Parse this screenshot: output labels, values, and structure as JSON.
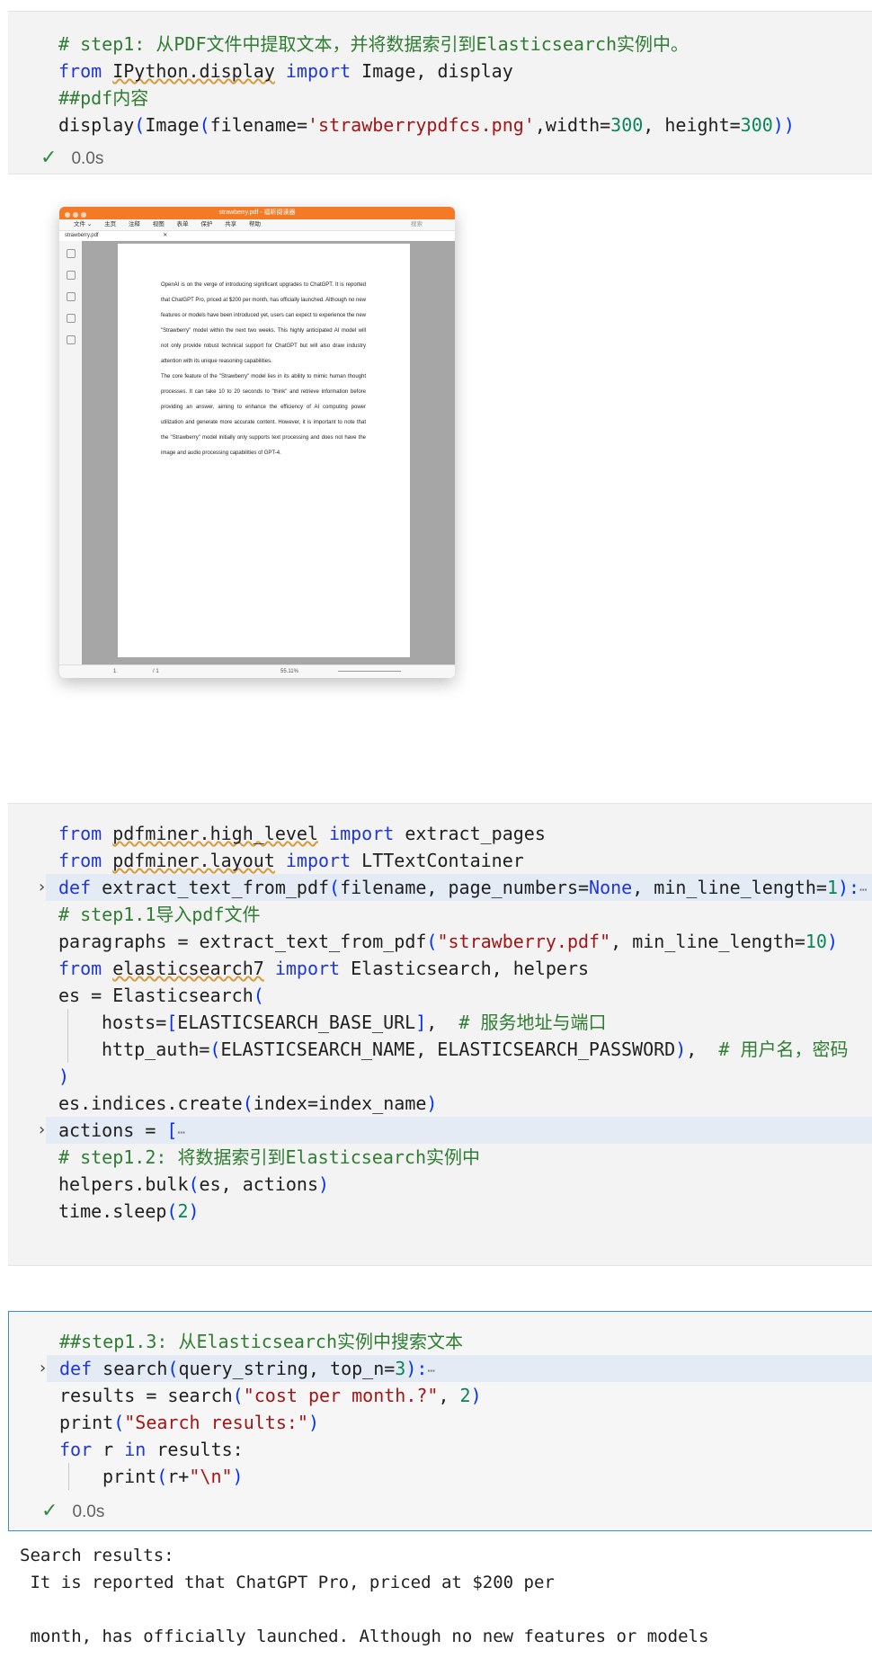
{
  "cell1": {
    "lines": {
      "l1": "# step1: 从PDF文件中提取文本，并将数据索引到Elasticsearch实例中。",
      "l2_from": "from",
      "l2_mod": "IPython.display",
      "l2_import": "import",
      "l2_rest": " Image, display",
      "l3": "##pdf内容",
      "l4_fn": "display",
      "l4_a": "(",
      "l4_b": "Image",
      "l4_c": "(",
      "l4_d": "filename=",
      "l4_str": "'strawberrypdfcs.png'",
      "l4_e": ",width=",
      "l4_n1": "300",
      "l4_f": ", height=",
      "l4_n2": "300",
      "l4_g": "))"
    },
    "status_time": "0.0s"
  },
  "embedded_screenshot": {
    "window_title": "strawberry.pdf - 福昕阅读器",
    "menu": [
      "文件 ⌄",
      "主页",
      "注释",
      "视图",
      "表单",
      "保护",
      "共享",
      "帮助"
    ],
    "tab": "strawberry.pdf",
    "tab_close": "✕",
    "search_placeholder": "搜索",
    "para1": "OpenAI is on the verge of introducing significant upgrades to ChatGPT. It is reported that ChatGPT Pro, priced at $200 per month, has officially launched. Although no new features or models have been introduced yet, users can expect to experience the new \"Strawberry\" model within the next two weeks. This highly anticipated AI model will not only provide robust technical support for ChatGPT but will also draw industry attention with its unique reasoning capabilities.",
    "para2": "The core feature of the \"Strawberry\" model lies in its ability to mimic human thought processes. It can take 10 to 20 seconds to \"think\" and retrieve information before providing an answer, aiming to enhance the efficiency of AI computing power utilization and generate more accurate content. However, it is important to note that the \"Strawberry\" model initially only supports text processing and does not have the image and audio processing capabilities of GPT-4.",
    "page_number": "1",
    "page_total": "/ 1",
    "zoom": "55.11%"
  },
  "cell2": {
    "l1_from": "from",
    "l1_mod": "pdfminer.high_level",
    "l1_import": "import",
    "l1_rest": " extract_pages",
    "l2_from": "from",
    "l2_mod": "pdfminer.layout",
    "l2_import": "import",
    "l2_rest": " LTTextContainer",
    "l3_def": "def",
    "l3_name": " extract_text_from_pdf",
    "l3_a": "(",
    "l3_b": "filename, page_numbers=",
    "l3_none": "None",
    "l3_c": ", min_line_length=",
    "l3_n": "1",
    "l3_d": "):",
    "l4": "# step1.1导入pdf文件",
    "l5_a": "paragraphs = extract_text_from_pdf",
    "l5_b": "(",
    "l5_str": "\"strawberry.pdf\"",
    "l5_c": ", min_line_length=",
    "l5_n": "10",
    "l5_d": ")",
    "l6_from": "from",
    "l6_mod": "elasticsearch7",
    "l6_import": "import",
    "l6_rest": " Elasticsearch, helpers",
    "l7_a": "es = Elasticsearch",
    "l7_b": "(",
    "l8_a": "hosts=",
    "l8_b": "[",
    "l8_c": "ELASTICSEARCH_BASE_URL",
    "l8_d": "]",
    "l8_e": ",  ",
    "l8_cm": "# 服务地址与端口",
    "l9_a": "http_auth=",
    "l9_b": "(",
    "l9_c": "ELASTICSEARCH_NAME, ELASTICSEARCH_PASSWORD",
    "l9_d": ")",
    "l9_e": ",  ",
    "l9_cm": "# 用户名，密码",
    "l10": ")",
    "l11_a": "es.indices.create",
    "l11_b": "(",
    "l11_c": "index=index_name",
    "l11_d": ")",
    "l12_a": "actions = ",
    "l12_b": "[",
    "l13": "# step1.2: 将数据索引到Elasticsearch实例中",
    "l14_a": "helpers.bulk",
    "l14_b": "(",
    "l14_c": "es, actions",
    "l14_d": ")",
    "l15_a": "time.sleep",
    "l15_b": "(",
    "l15_n": "2",
    "l15_d": ")"
  },
  "cell3": {
    "l1": "##step1.3: 从Elasticsearch实例中搜索文本",
    "l2_def": "def",
    "l2_name": " search",
    "l2_a": "(",
    "l2_b": "query_string, top_n=",
    "l2_n": "3",
    "l2_c": "):",
    "l3_a": "results = search",
    "l3_b": "(",
    "l3_str": "\"cost per month.?\"",
    "l3_c": ", ",
    "l3_n": "2",
    "l3_d": ")",
    "l4_a": "print",
    "l4_b": "(",
    "l4_str": "\"Search results:\"",
    "l4_c": ")",
    "l5_for": "for",
    "l5_r": " r ",
    "l5_in": "in",
    "l5_rest": " results:",
    "l6_a": "print",
    "l6_b": "(",
    "l6_c": "r+",
    "l6_str": "\"\\n\"",
    "l6_d": ")",
    "status_time": "0.0s"
  },
  "output": {
    "line1": "Search results:",
    "line2": " It is reported that ChatGPT Pro, priced at $200 per",
    "line3": "",
    "line4": " month, has officially launched. Although no new features or models"
  },
  "icons": {
    "check": "check-icon",
    "fold": "chevron-right-icon",
    "ellipsis": "ellipsis-icon"
  }
}
